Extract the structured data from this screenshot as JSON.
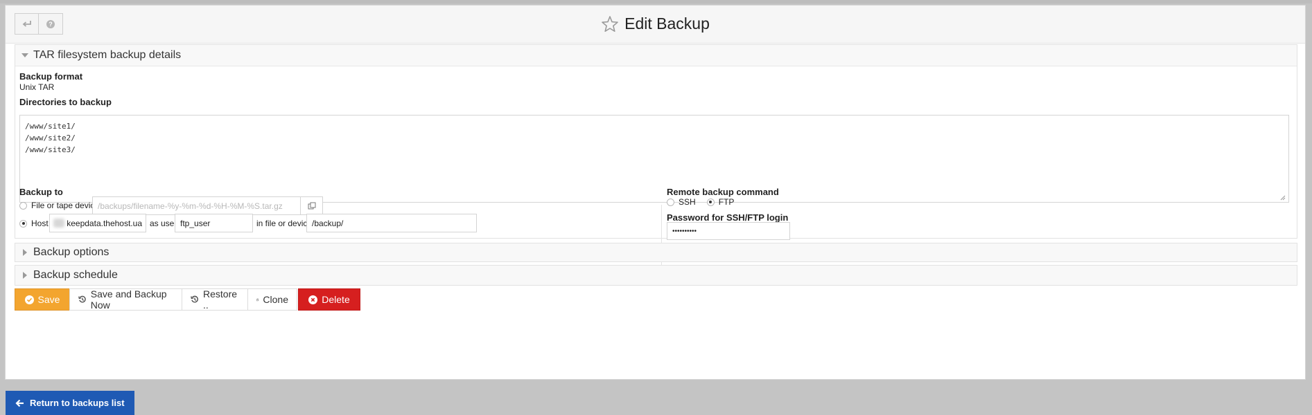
{
  "header": {
    "title": "Edit Backup"
  },
  "sections": {
    "tar": {
      "title": "TAR filesystem backup details",
      "format_label": "Backup format",
      "format_value": "Unix TAR",
      "dirs_label": "Directories to backup",
      "dirs_value": "/www/site1/\n/www/site2/\n/www/site3/",
      "backup_to_label": "Backup to",
      "file_option_label": "File or tape device",
      "file_placeholder": "/backups/filename-%y-%m-%d-%H-%M-%S.tar.gz",
      "host_option_label": "Host",
      "host_value": "keepdata.thehost.ua",
      "as_user_label": "as user",
      "user_value": "ftp_user",
      "in_file_label": "in file or device",
      "path_value": "/backup/",
      "remote_cmd_label": "Remote backup command",
      "ssh_label": "SSH",
      "ftp_label": "FTP",
      "password_label": "Password for SSH/FTP login",
      "password_value": "••••••••••"
    },
    "options": {
      "title": "Backup options"
    },
    "schedule": {
      "title": "Backup schedule"
    }
  },
  "actions": {
    "save": "Save",
    "save_backup_now": "Save and Backup Now",
    "restore": "Restore ..",
    "clone": "Clone",
    "delete": "Delete"
  },
  "footer": {
    "return_label": "Return to backups list"
  },
  "colors": {
    "save": "#f3a52f",
    "delete": "#d61f1f",
    "return": "#1f5ab4"
  }
}
